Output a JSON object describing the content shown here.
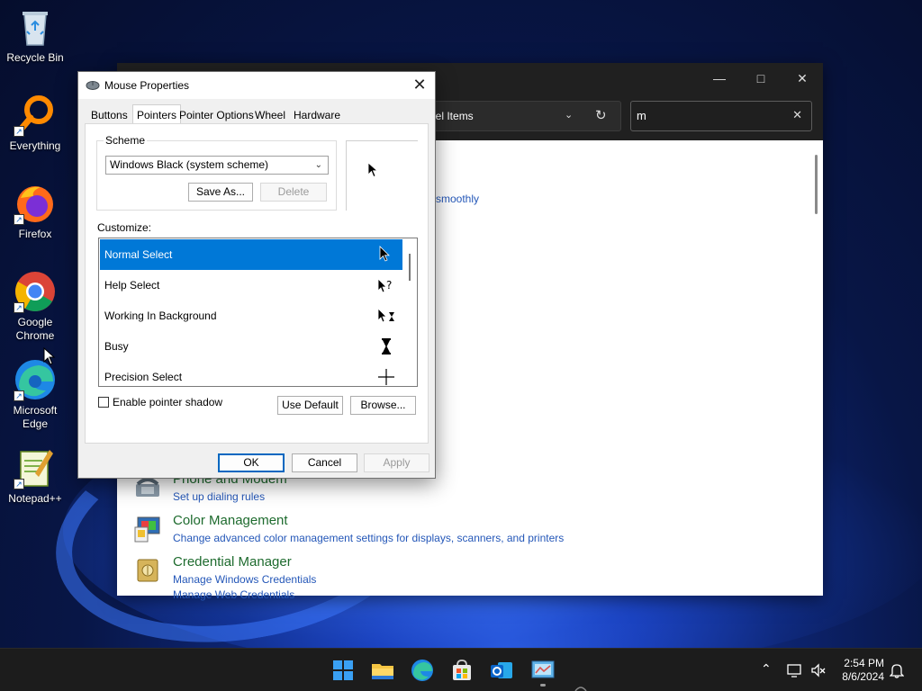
{
  "desktop": {
    "icons": [
      {
        "label": "Recycle Bin"
      },
      {
        "label": "Everything"
      },
      {
        "label": "Firefox"
      },
      {
        "label": "Google Chrome"
      },
      {
        "label": "Microsoft Edge"
      },
      {
        "label": "Notepad++"
      }
    ]
  },
  "control_panel": {
    "address_fragment": "nel Items",
    "search_value": "m",
    "visible_link_fragment": "smoothly",
    "items": [
      {
        "title": "Phone and Modem",
        "subs": [
          "Set up dialing rules"
        ]
      },
      {
        "title": "Color Management",
        "subs": [
          "Change advanced color management settings for displays, scanners, and printers"
        ]
      },
      {
        "title": "Credential Manager",
        "subs": [
          "Manage Windows Credentials",
          "Manage Web Credentials"
        ]
      }
    ]
  },
  "dialog": {
    "title": "Mouse Properties",
    "tabs": [
      "Buttons",
      "Pointers",
      "Pointer Options",
      "Wheel",
      "Hardware"
    ],
    "active_tab": "Pointers",
    "scheme": {
      "label": "Scheme",
      "selected": "Windows Black (system scheme)",
      "save_as": "Save As...",
      "delete": "Delete"
    },
    "customize_label": "Customize:",
    "pointers": [
      {
        "name": "Normal Select",
        "selected": true
      },
      {
        "name": "Help Select"
      },
      {
        "name": "Working In Background"
      },
      {
        "name": "Busy"
      },
      {
        "name": "Precision Select"
      }
    ],
    "shadow_label": "Enable pointer shadow",
    "use_default": "Use Default",
    "browse": "Browse...",
    "ok": "OK",
    "cancel": "Cancel",
    "apply": "Apply"
  },
  "taskbar": {
    "time": "2:54 PM",
    "date": "8/6/2024"
  }
}
